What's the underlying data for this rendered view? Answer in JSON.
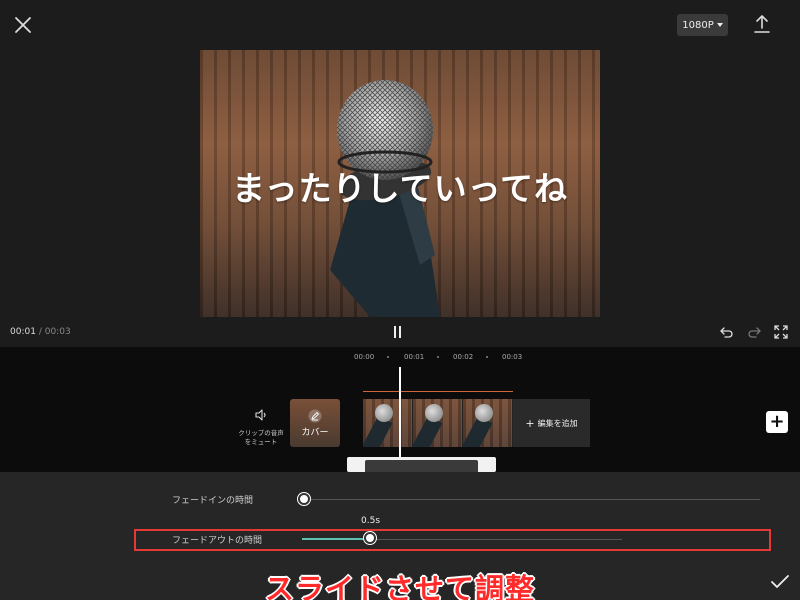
{
  "topbar": {
    "resolution": "1080P",
    "close_icon": "close-icon",
    "export_icon": "export-icon"
  },
  "preview": {
    "caption": "まったりしていってね"
  },
  "playback": {
    "current": "00:01",
    "separator": "/",
    "total": "00:03",
    "icons": [
      "undo-icon",
      "redo-icon",
      "fullscreen-icon"
    ]
  },
  "timeline": {
    "ruler": [
      "00:00",
      "00:01",
      "00:02",
      "00:03"
    ],
    "mute_label": "クリップの音声をミュート",
    "cover_label": "カバー",
    "add_edit_label": "編集を追加",
    "add_track_symbol": "+"
  },
  "fade": {
    "fade_in_label": "フェードインの時間",
    "fade_in_value": 0,
    "fade_out_label": "フェードアウトの時間",
    "fade_out_value_text": "0.5s"
  },
  "annotation": {
    "note": "スライドさせて調整",
    "color": "#ff2a2a"
  },
  "colors": {
    "accent": "#5fbfb0",
    "highlight": "#e53935",
    "timeline_marker": "#d0643a"
  }
}
